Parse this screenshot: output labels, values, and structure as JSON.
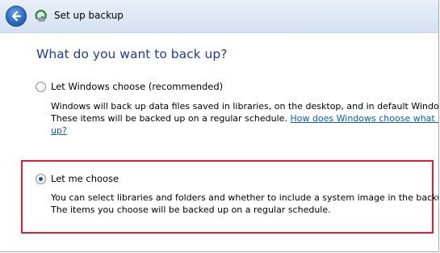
{
  "window": {
    "title": "Set up backup",
    "back_icon": "back-arrow-icon",
    "app_icon": "backup-icon",
    "accent_color": "#2a6cc4"
  },
  "main": {
    "heading": "What do you want to back up?",
    "options": [
      {
        "label": "Let Windows choose (recommended)",
        "selected": false,
        "description_lines": [
          "Windows will back up data files saved in libraries, on the desktop, and in default Windows f"
        ],
        "description_line2_prefix": "These items will be backed up on a regular schedule. ",
        "link_text_line1": "How does Windows choose what file",
        "link_text_line2": "up?"
      },
      {
        "label": "Let me choose",
        "selected": true,
        "description_lines": [
          "You can select libraries and folders and whether to include a system image in the backup.",
          "The items you choose will be backed up on a regular schedule."
        ]
      }
    ]
  },
  "highlight": {
    "color": "#e0202c"
  }
}
